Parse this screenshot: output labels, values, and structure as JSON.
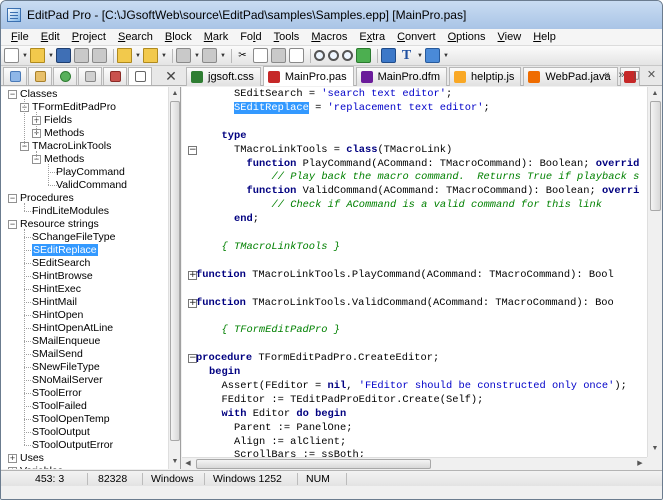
{
  "window": {
    "title": "EditPad Pro - [C:\\JGsoftWeb\\source\\EditPad\\samples\\Samples.epp] [MainPro.pas]"
  },
  "menu": [
    {
      "label": "File",
      "accel": "F"
    },
    {
      "label": "Edit",
      "accel": "E"
    },
    {
      "label": "Project",
      "accel": "P"
    },
    {
      "label": "Search",
      "accel": "S"
    },
    {
      "label": "Block",
      "accel": "B"
    },
    {
      "label": "Mark",
      "accel": "M"
    },
    {
      "label": "Fold",
      "accel": "l"
    },
    {
      "label": "Tools",
      "accel": "T"
    },
    {
      "label": "Macros",
      "accel": "M"
    },
    {
      "label": "Extra",
      "accel": "x"
    },
    {
      "label": "Convert",
      "accel": "C"
    },
    {
      "label": "Options",
      "accel": "O"
    },
    {
      "label": "View",
      "accel": "V"
    },
    {
      "label": "Help",
      "accel": "H"
    }
  ],
  "tabs": [
    {
      "label": "jgsoft.css",
      "icon": "css-file-icon",
      "color": "#2e7d32",
      "active": false
    },
    {
      "label": "MainPro.pas",
      "icon": "pascal-file-icon",
      "color": "#c62828",
      "active": true
    },
    {
      "label": "MainPro.dfm",
      "icon": "dfm-file-icon",
      "color": "#6a1b9a",
      "active": false
    },
    {
      "label": "helptip.js",
      "icon": "js-file-icon",
      "color": "#f9a825",
      "active": false
    },
    {
      "label": "WebPad.java",
      "icon": "java-file-icon",
      "color": "#ef6c00",
      "active": false
    }
  ],
  "tree": [
    {
      "label": "Classes",
      "level": 0,
      "toggle": "-"
    },
    {
      "label": "TFormEditPadPro",
      "level": 1,
      "toggle": "-"
    },
    {
      "label": "Fields",
      "level": 2,
      "toggle": "+"
    },
    {
      "label": "Methods",
      "level": 2,
      "toggle": "+"
    },
    {
      "label": "TMacroLinkTools",
      "level": 1,
      "toggle": "-"
    },
    {
      "label": "Methods",
      "level": 2,
      "toggle": "-"
    },
    {
      "label": "PlayCommand",
      "level": 3,
      "toggle": ""
    },
    {
      "label": "ValidCommand",
      "level": 3,
      "toggle": ""
    },
    {
      "label": "Procedures",
      "level": 0,
      "toggle": "-"
    },
    {
      "label": "FindLiteModules",
      "level": 1,
      "toggle": ""
    },
    {
      "label": "Resource strings",
      "level": 0,
      "toggle": "-"
    },
    {
      "label": "SChangeFileType",
      "level": 1,
      "toggle": ""
    },
    {
      "label": "SEditReplace",
      "level": 1,
      "toggle": "",
      "selected": true
    },
    {
      "label": "SEditSearch",
      "level": 1,
      "toggle": ""
    },
    {
      "label": "SHintBrowse",
      "level": 1,
      "toggle": ""
    },
    {
      "label": "SHintExec",
      "level": 1,
      "toggle": ""
    },
    {
      "label": "SHintMail",
      "level": 1,
      "toggle": ""
    },
    {
      "label": "SHintOpen",
      "level": 1,
      "toggle": ""
    },
    {
      "label": "SHintOpenAtLine",
      "level": 1,
      "toggle": ""
    },
    {
      "label": "SMailEnqueue",
      "level": 1,
      "toggle": ""
    },
    {
      "label": "SMailSend",
      "level": 1,
      "toggle": ""
    },
    {
      "label": "SNewFileType",
      "level": 1,
      "toggle": ""
    },
    {
      "label": "SNoMailServer",
      "level": 1,
      "toggle": ""
    },
    {
      "label": "SToolError",
      "level": 1,
      "toggle": ""
    },
    {
      "label": "SToolFailed",
      "level": 1,
      "toggle": ""
    },
    {
      "label": "SToolOpenTemp",
      "level": 1,
      "toggle": ""
    },
    {
      "label": "SToolOutput",
      "level": 1,
      "toggle": ""
    },
    {
      "label": "SToolOutputError",
      "level": 1,
      "toggle": ""
    },
    {
      "label": "Uses",
      "level": 0,
      "toggle": "+"
    },
    {
      "label": "Variables",
      "level": 0,
      "toggle": "+"
    }
  ],
  "code": [
    {
      "fold": "",
      "indent": 4,
      "tokens": [
        [
          "id",
          "SEditSearch = "
        ],
        [
          "str",
          "'search text editor'"
        ],
        [
          "id",
          ";"
        ]
      ]
    },
    {
      "fold": "",
      "indent": 4,
      "tokens": [
        [
          "sel",
          "SEditReplace"
        ],
        [
          "id",
          " = "
        ],
        [
          "str",
          "'replacement text editor'"
        ],
        [
          "id",
          ";"
        ]
      ]
    },
    {
      "fold": "",
      "indent": 0,
      "tokens": []
    },
    {
      "fold": "",
      "indent": 2,
      "tokens": [
        [
          "kw",
          "type"
        ]
      ]
    },
    {
      "fold": "-",
      "indent": 4,
      "tokens": [
        [
          "id",
          "TMacroLinkTools = "
        ],
        [
          "kw",
          "class"
        ],
        [
          "id",
          "(TMacroLink)"
        ]
      ]
    },
    {
      "fold": "",
      "indent": 6,
      "tokens": [
        [
          "kw",
          "function"
        ],
        [
          "id",
          " PlayCommand(ACommand: TMacroCommand): Boolean; "
        ],
        [
          "kw",
          "overrid"
        ]
      ]
    },
    {
      "fold": "",
      "indent": 10,
      "tokens": [
        [
          "com",
          "// Play back the macro command.  Returns True if playback s"
        ]
      ]
    },
    {
      "fold": "",
      "indent": 6,
      "tokens": [
        [
          "kw",
          "function"
        ],
        [
          "id",
          " ValidCommand(ACommand: TMacroCommand): Boolean; "
        ],
        [
          "kw",
          "overri"
        ]
      ]
    },
    {
      "fold": "",
      "indent": 10,
      "tokens": [
        [
          "com",
          "// Check if ACommand is a valid command for this link"
        ]
      ]
    },
    {
      "fold": "",
      "indent": 4,
      "tokens": [
        [
          "kw",
          "end"
        ],
        [
          "id",
          ";"
        ]
      ]
    },
    {
      "fold": "",
      "indent": 0,
      "tokens": []
    },
    {
      "fold": "",
      "indent": 2,
      "tokens": [
        [
          "com",
          "{ TMacroLinkTools }"
        ]
      ]
    },
    {
      "fold": "",
      "indent": 0,
      "tokens": []
    },
    {
      "fold": "+",
      "indent": 0,
      "tokens": [
        [
          "kw",
          "function"
        ],
        [
          "id",
          " TMacroLinkTools.PlayCommand(ACommand: TMacroCommand): Bool"
        ]
      ]
    },
    {
      "fold": "",
      "indent": 0,
      "tokens": []
    },
    {
      "fold": "+",
      "indent": 0,
      "tokens": [
        [
          "kw",
          "function"
        ],
        [
          "id",
          " TMacroLinkTools.ValidCommand(ACommand: TMacroCommand): Boo"
        ]
      ]
    },
    {
      "fold": "",
      "indent": 0,
      "tokens": []
    },
    {
      "fold": "",
      "indent": 2,
      "tokens": [
        [
          "com",
          "{ TFormEditPadPro }"
        ]
      ]
    },
    {
      "fold": "",
      "indent": 0,
      "tokens": []
    },
    {
      "fold": "-",
      "indent": 0,
      "tokens": [
        [
          "kw",
          "procedure"
        ],
        [
          "id",
          " TFormEditPadPro.CreateEditor;"
        ]
      ]
    },
    {
      "fold": "",
      "indent": 0,
      "tokens": [
        [
          "kw",
          "begin"
        ]
      ]
    },
    {
      "fold": "",
      "indent": 2,
      "tokens": [
        [
          "id",
          "Assert(FEditor = "
        ],
        [
          "kw",
          "nil"
        ],
        [
          "id",
          ", "
        ],
        [
          "str",
          "'FEditor should be constructed only once'"
        ],
        [
          "id",
          ");"
        ]
      ]
    },
    {
      "fold": "",
      "indent": 2,
      "tokens": [
        [
          "id",
          "FEditor := TEditPadProEditor.Create(Self);"
        ]
      ]
    },
    {
      "fold": "",
      "indent": 2,
      "tokens": [
        [
          "kw",
          "with"
        ],
        [
          "id",
          " Editor "
        ],
        [
          "kw",
          "do"
        ],
        [
          "id",
          " "
        ],
        [
          "kw",
          "begin"
        ]
      ]
    },
    {
      "fold": "",
      "indent": 4,
      "tokens": [
        [
          "id",
          "Parent := PanelOne;"
        ]
      ]
    },
    {
      "fold": "",
      "indent": 4,
      "tokens": [
        [
          "id",
          "Align := alClient;"
        ]
      ]
    },
    {
      "fold": "",
      "indent": 4,
      "tokens": [
        [
          "id",
          "ScrollBars := ssBoth;"
        ]
      ]
    }
  ],
  "status": {
    "position": "453: 3",
    "size": "82328",
    "line_breaks": "Windows",
    "encoding": "Windows 1252",
    "num": "NUM"
  },
  "colors": {
    "keyword": "#000080",
    "string": "#0000c8",
    "comment": "#008000",
    "selection": "#3399ff"
  }
}
